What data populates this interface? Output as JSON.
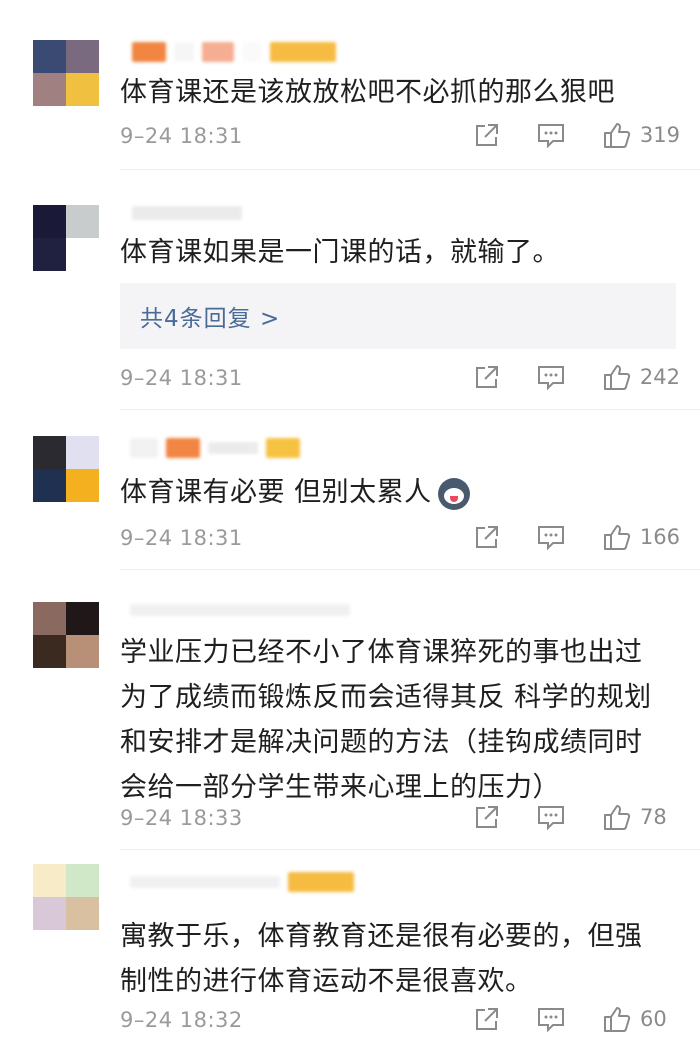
{
  "colors": {
    "text": "#1f1f1f",
    "meta": "#9a9a9a",
    "link": "#4a6b98",
    "reply_bg": "#f4f4f6"
  },
  "comments": [
    {
      "text": "体育课还是该放放松吧不必抓的那么狠吧",
      "time": "9–24 18:31",
      "likes": "319",
      "avatar_colors": [
        "#3b4a73",
        "#7a6a80",
        "#a08080",
        "#f0c040"
      ]
    },
    {
      "text": "体育课如果是一门课的话，就输了。",
      "replies": "共4条回复 >",
      "time": "9–24 18:31",
      "likes": "242",
      "avatar_colors": [
        "#1a1a38",
        "#c8cccc",
        "#202040",
        "#ffffff"
      ]
    },
    {
      "text": "体育课有必要 但别太累人",
      "time": "9–24 18:31",
      "likes": "166",
      "avatar_colors": [
        "#2a2a30",
        "#e0e0f0",
        "#203050",
        "#f5b020"
      ]
    },
    {
      "text_lines": [
        "学业压力已经不小了体育课猝死的事也出过",
        "为了成绩而锻炼反而会适得其反 科学的规划",
        "和安排才是解决问题的方法（挂钩成绩同时",
        "会给一部分学生带来心理上的压力）"
      ],
      "time": "9–24 18:33",
      "likes": "78",
      "avatar_colors": [
        "#8a6a60",
        "#201818",
        "#3a2a20",
        "#b89078"
      ]
    },
    {
      "text_lines": [
        "寓教于乐，体育教育还是很有必要的，但强",
        "制性的进行体育运动不是很喜欢。"
      ],
      "time": "9–24 18:32",
      "likes": "60",
      "avatar_colors": [
        "#f8ecc8",
        "#d0e8c8",
        "#d8c8d8",
        "#d8c0a0"
      ]
    }
  ],
  "icons": {
    "share": "share-icon",
    "comment": "comment-icon",
    "like": "thumbs-up-icon",
    "emoji": "husky-dog-emoji-icon"
  }
}
